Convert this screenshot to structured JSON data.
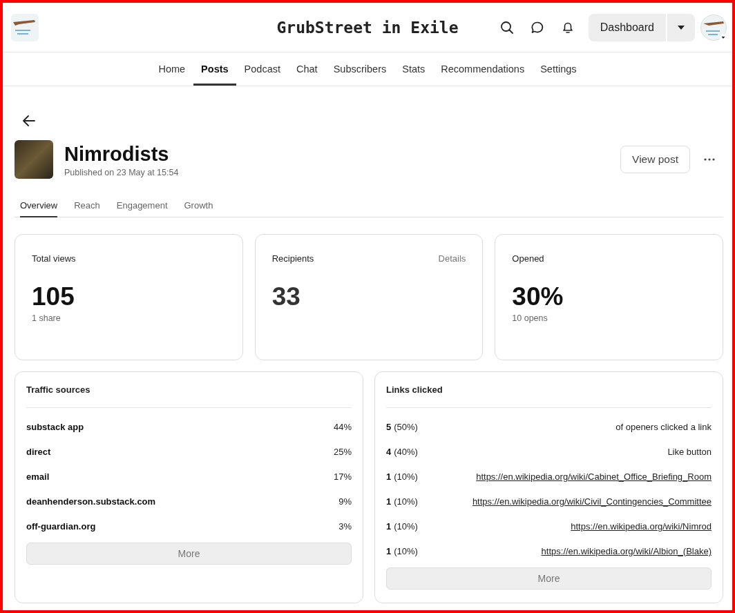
{
  "header": {
    "title": "GrubStreet in Exile",
    "dashboard_button": "Dashboard"
  },
  "nav": [
    {
      "label": "Home",
      "selected": false
    },
    {
      "label": "Posts",
      "selected": true
    },
    {
      "label": "Podcast",
      "selected": false
    },
    {
      "label": "Chat",
      "selected": false
    },
    {
      "label": "Subscribers",
      "selected": false
    },
    {
      "label": "Stats",
      "selected": false
    },
    {
      "label": "Recommendations",
      "selected": false
    },
    {
      "label": "Settings",
      "selected": false
    }
  ],
  "post": {
    "title": "Nimrodists",
    "published": "Published on 23 May at 15:54",
    "view_button": "View post"
  },
  "tabs": [
    {
      "label": "Overview",
      "selected": true
    },
    {
      "label": "Reach",
      "selected": false
    },
    {
      "label": "Engagement",
      "selected": false
    },
    {
      "label": "Growth",
      "selected": false
    }
  ],
  "stat_cards": [
    {
      "label": "Total views",
      "value": "105",
      "sub": "1 share"
    },
    {
      "label": "Recipients",
      "value": "33",
      "link": "Details"
    },
    {
      "label": "Opened",
      "value": "30%",
      "sub": "10 opens"
    }
  ],
  "traffic_sources": {
    "title": "Traffic sources",
    "rows": [
      {
        "name": "substack app",
        "share": "44%"
      },
      {
        "name": "direct",
        "share": "25%"
      },
      {
        "name": "email",
        "share": "17%"
      },
      {
        "name": "deanhenderson.substack.com",
        "share": "9%"
      },
      {
        "name": "off-guardian.org",
        "share": "3%"
      }
    ],
    "more_button": "More"
  },
  "links_clicked": {
    "title": "Links clicked",
    "rows": [
      {
        "count": "5",
        "percent": "(50%)",
        "target": "of openers clicked a link",
        "kind": "text"
      },
      {
        "count": "4",
        "percent": "(40%)",
        "target": "Like button",
        "kind": "text"
      },
      {
        "count": "1",
        "percent": "(10%)",
        "target": "https://en.wikipedia.org/wiki/Cabinet_Office_Briefing_Room",
        "kind": "link"
      },
      {
        "count": "1",
        "percent": "(10%)",
        "target": "https://en.wikipedia.org/wiki/Civil_Contingencies_Committee",
        "kind": "link"
      },
      {
        "count": "1",
        "percent": "(10%)",
        "target": "https://en.wikipedia.org/wiki/Nimrod",
        "kind": "link"
      },
      {
        "count": "1",
        "percent": "(10%)",
        "target": "https://en.wikipedia.org/wiki/Albion_(Blake)",
        "kind": "link"
      }
    ],
    "more_button": "More"
  }
}
